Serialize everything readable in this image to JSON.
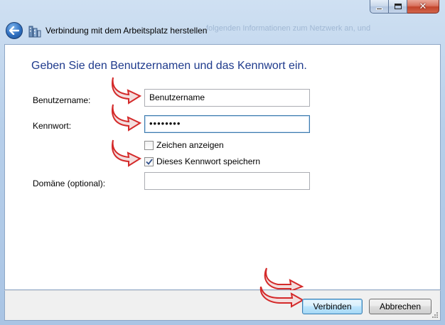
{
  "window": {
    "title": "Verbindung mit dem Arbeitsplatz herstellen",
    "background_hint_text": "folgenden Informationen zum Netzwerk an, und"
  },
  "header": {
    "back_icon": "back-arrow-icon",
    "app_icon": "remote-workplace-icon"
  },
  "form": {
    "heading": "Geben Sie den Benutzernamen und das Kennwort ein.",
    "username_label": "Benutzername:",
    "username_value": "Benutzername",
    "password_label": "Kennwort:",
    "password_value": "••••••••",
    "show_chars_label": "Zeichen anzeigen",
    "show_chars_checked": false,
    "save_pw_label": "Dieses Kennwort speichern",
    "save_pw_checked": true,
    "domain_label": "Domäne (optional):",
    "domain_value": ""
  },
  "footer": {
    "connect_label": "Verbinden",
    "cancel_label": "Abbrechen"
  },
  "colors": {
    "heading": "#1e3a8c",
    "annotation_arrow": "#d42a2a",
    "close_button": "#c2442b"
  }
}
